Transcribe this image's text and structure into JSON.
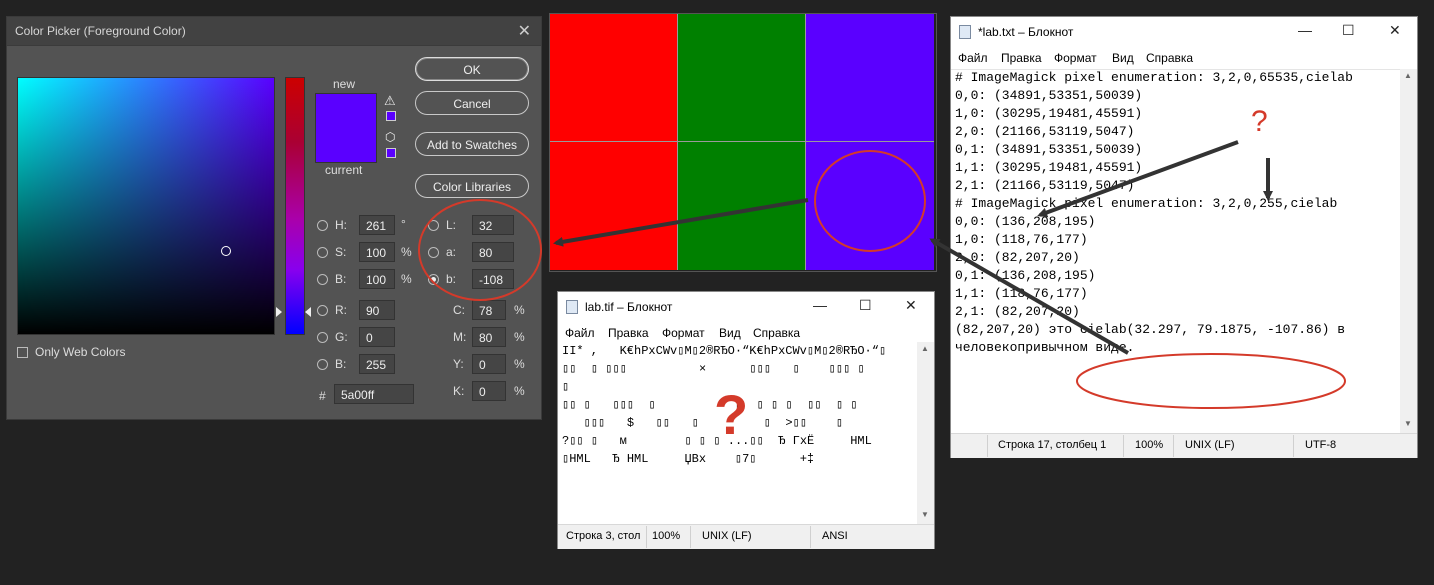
{
  "picker": {
    "title": "Color Picker (Foreground Color)",
    "new_label": "new",
    "current_label": "current",
    "buttons": {
      "ok": "OK",
      "cancel": "Cancel",
      "add_swatches": "Add to Swatches",
      "libraries": "Color Libraries"
    },
    "only_web": "Only Web Colors",
    "hsb": {
      "h_label": "H:",
      "h": "261",
      "h_unit": "°",
      "s_label": "S:",
      "s": "100",
      "s_unit": "%",
      "b_label": "B:",
      "b": "100",
      "b_unit": "%"
    },
    "lab": {
      "l_label": "L:",
      "l": "32",
      "a_label": "a:",
      "a": "80",
      "b_label": "b:",
      "b": "-108"
    },
    "rgb": {
      "r_label": "R:",
      "r": "90",
      "g_label": "G:",
      "g": "0",
      "b_label": "B:",
      "b": "255"
    },
    "cmyk": {
      "c_label": "C:",
      "c": "78",
      "m_label": "M:",
      "m": "80",
      "y_label": "Y:",
      "y": "0",
      "k_label": "K:",
      "k": "0",
      "unit": "%"
    },
    "hex_label": "#",
    "hex": "5a00ff",
    "color": "#5a00ff"
  },
  "canvas": {
    "colors": [
      "#ff0000",
      "#008000",
      "#5a00ff"
    ]
  },
  "lab_txt": {
    "title": "*lab.txt – Блокнот",
    "menu": [
      "Файл",
      "Правка",
      "Формат",
      "Вид",
      "Справка"
    ],
    "lines": [
      "# ImageMagick pixel enumeration: 3,2,0,65535,cielab",
      "0,0: (34891,53351,50039)",
      "1,0: (30295,19481,45591)",
      "2,0: (21166,53119,5047)",
      "0,1: (34891,53351,50039)",
      "1,1: (30295,19481,45591)",
      "2,1: (21166,53119,5047)",
      "",
      "# ImageMagick pixel enumeration: 3,2,0,255,cielab",
      "0,0: (136,208,195)",
      "1,0: (118,76,177)",
      "2,0: (82,207,20)",
      "0,1: (136,208,195)",
      "1,1: (118,76,177)",
      "2,1: (82,207,20)",
      "",
      "",
      "(82,207,20) это cielab(32.297, 79.1875, -107.86) в",
      "человекопривычном виде."
    ],
    "status": {
      "pos": "Строка 17, столбец 1",
      "zoom": "100%",
      "eol": "UNIX (LF)",
      "enc": "UTF-8"
    },
    "question": "?"
  },
  "lab_tif": {
    "title": "lab.tif – Блокнот",
    "menu": [
      "Файл",
      "Правка",
      "Формат",
      "Вид",
      "Справка"
    ],
    "lines": [
      "II* ,   K€hPxCWv▯M▯2®RЂO·“K€hPxCWv▯M▯2®RЂO·“▯",
      "▯▯  ▯ ▯▯▯          ×      ▯▯▯   ▯    ▯▯▯ ▯",
      "▯",
      "▯▯ ▯   ▯▯▯  ▯           ▯  ▯ ▯ ▯  ▯▯  ▯ ▯",
      "   ▯▯▯   $   ▯▯   ▯         ▯  >▯▯    ▯",
      "?▯▯ ▯   м        ▯ ▯ ▯ ...▯▯  Ђ ГхЁ     HML",
      "▯HML   Ђ HML     ЏBх    ▯7▯      +‡"
    ],
    "status": {
      "pos": "Строка 3, стол",
      "zoom": "100%",
      "eol": "UNIX (LF)",
      "enc": "ANSI"
    },
    "question": "?"
  }
}
